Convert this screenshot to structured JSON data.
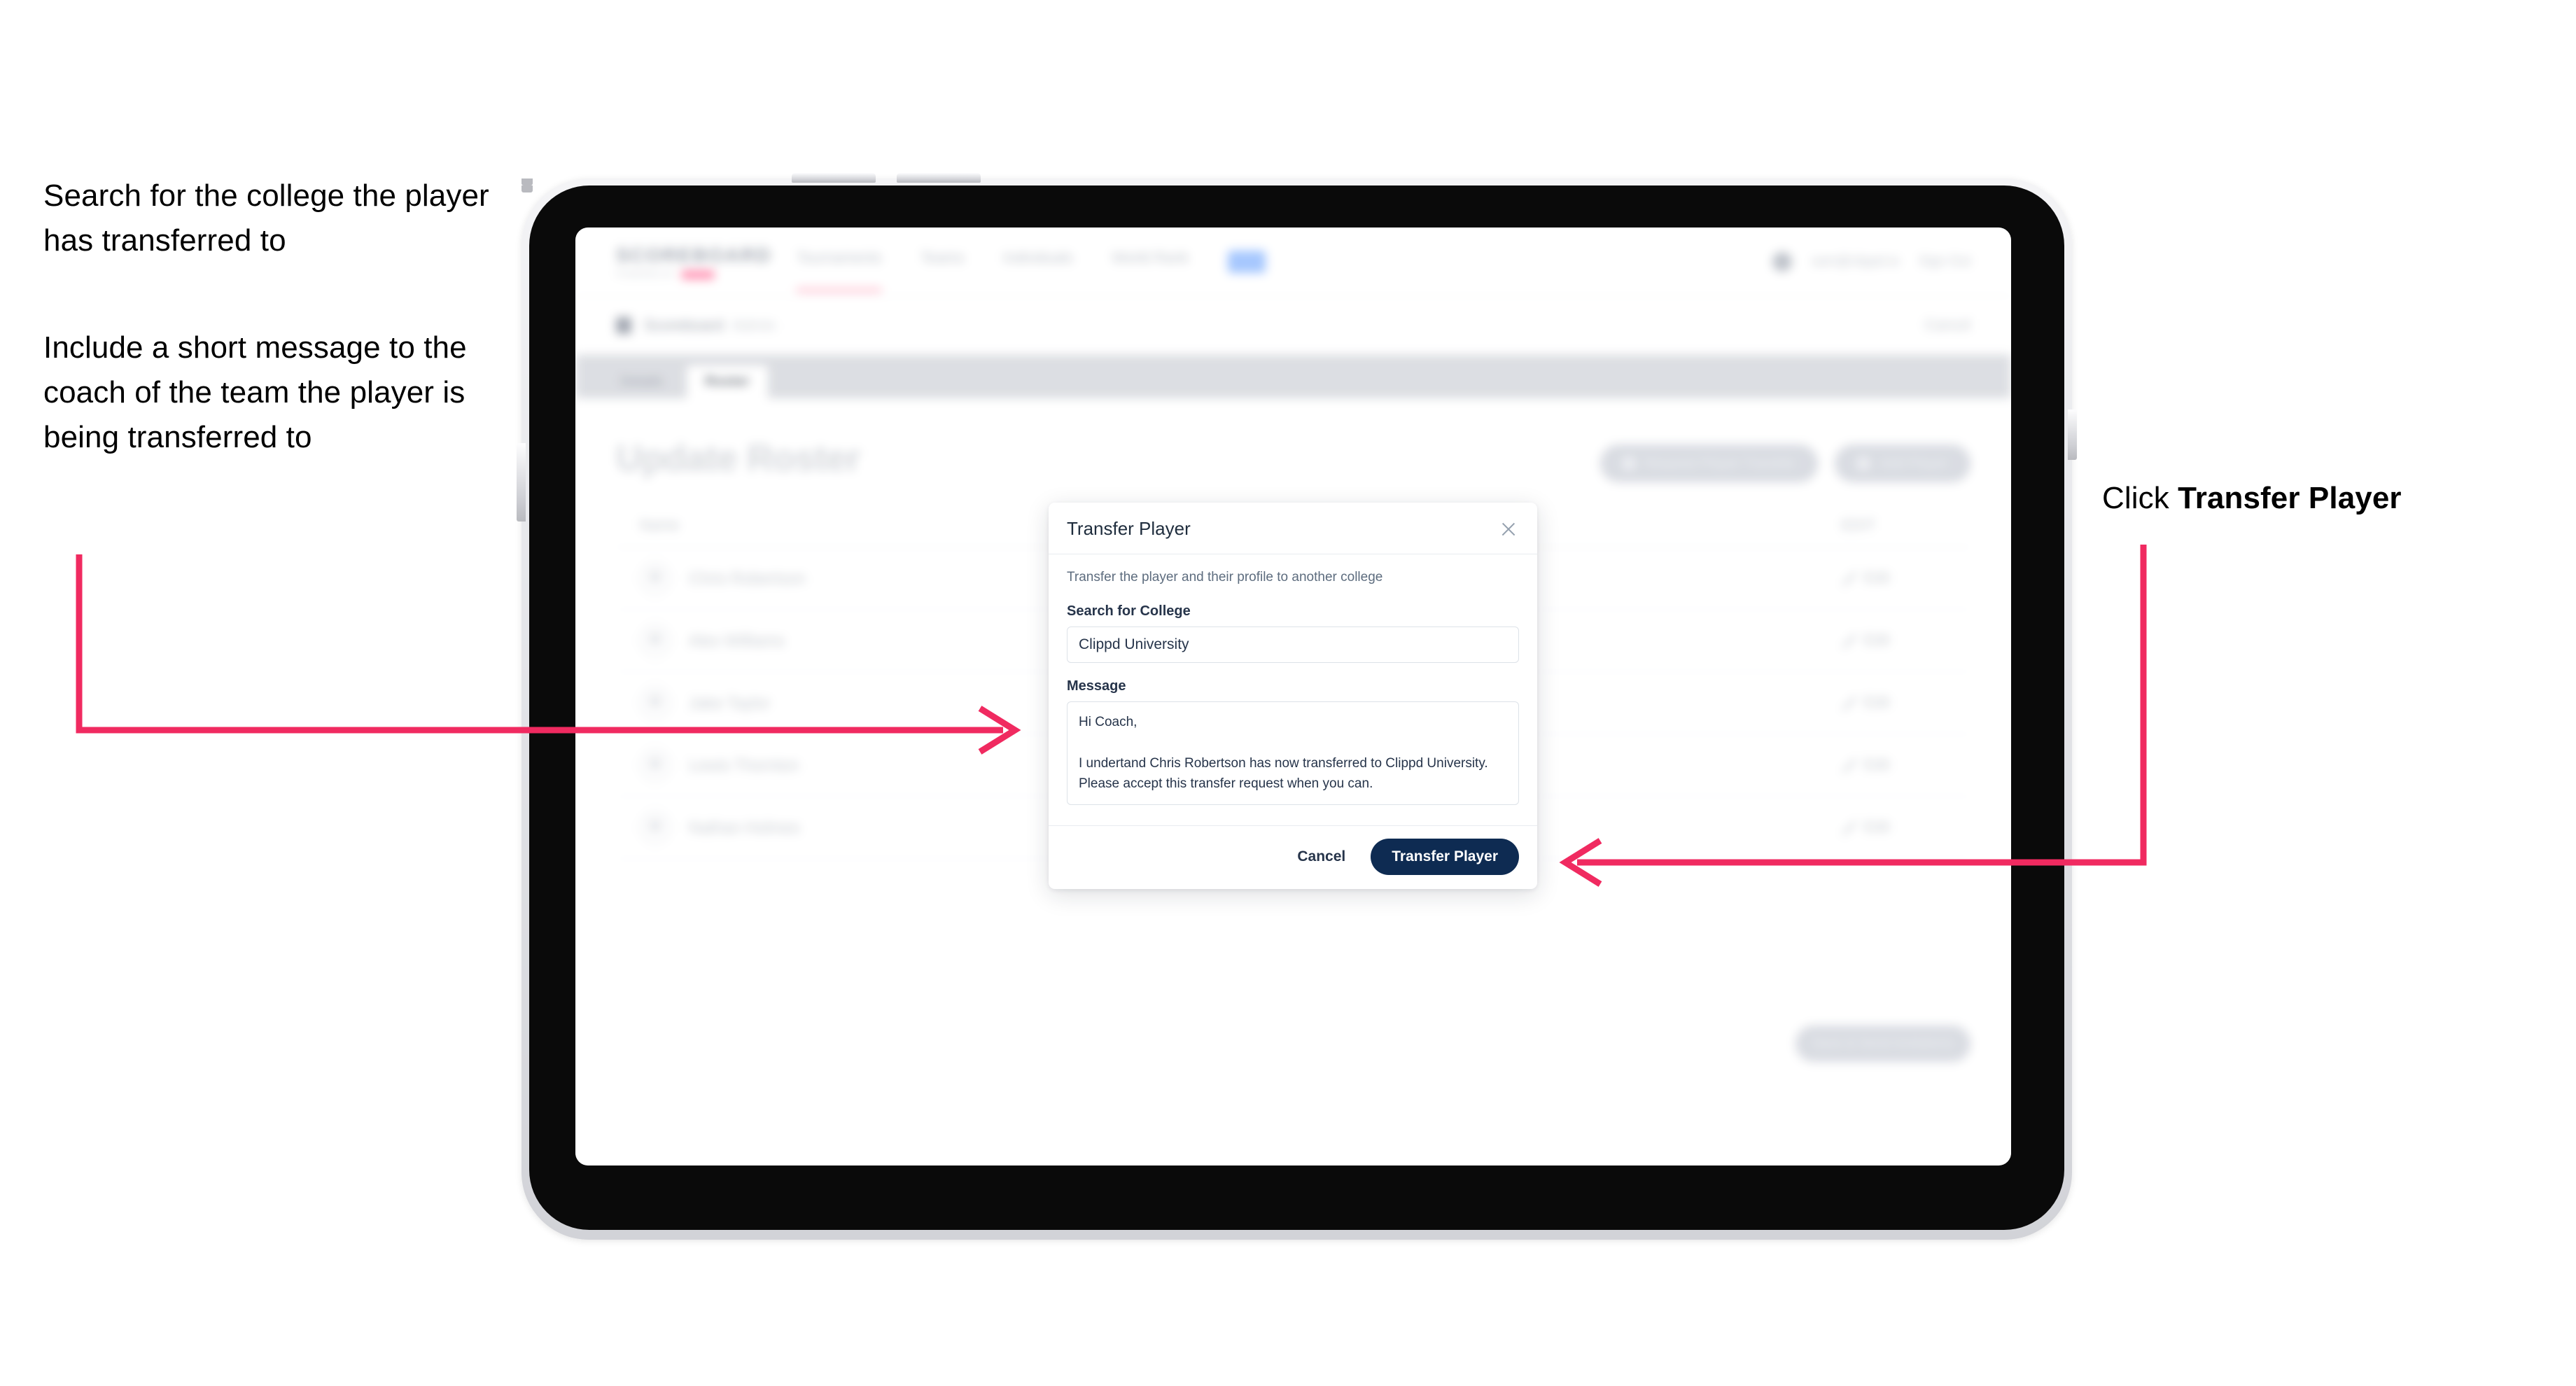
{
  "annotations": {
    "left_1": "Search for the college the player has transferred to",
    "left_2": "Include a short message to the coach of the team the player is being transferred to",
    "right_1_prefix": "Click ",
    "right_1_bold": "Transfer Player",
    "arrow_color": "#f02a60"
  },
  "app": {
    "brand": {
      "word": "SCOREBOARD",
      "sub_text": "POWERED BY"
    },
    "topnav": {
      "links": [
        {
          "label": "Tournaments"
        },
        {
          "label": "Teams"
        },
        {
          "label": "Individuals"
        },
        {
          "label": "World Rank"
        }
      ],
      "chip_label": "",
      "right": {
        "account": "sam@clippd.io",
        "signout": "Sign Out"
      }
    },
    "breadcrumb": {
      "main": "Scoreboard",
      "sub": "Admin",
      "right": "Cancel"
    },
    "tabs": [
      {
        "label": "Details",
        "active": false
      },
      {
        "label": "Roster",
        "active": true
      }
    ],
    "page_title": "Update Roster",
    "actions": [
      {
        "label": "Request Player Transfer"
      },
      {
        "label": "Add Player"
      }
    ],
    "roster": {
      "columns": {
        "name": "Name",
        "edit": "EDIT"
      },
      "rows": [
        {
          "name": "Chris Robertson",
          "edit": "Edit"
        },
        {
          "name": "Alex Williams",
          "edit": "Edit"
        },
        {
          "name": "Jake Taylor",
          "edit": "Edit"
        },
        {
          "name": "Lewis Thornton",
          "edit": "Edit"
        },
        {
          "name": "Nathan Holmes",
          "edit": "Edit"
        }
      ]
    },
    "bottom_cta": "Save & Send Invitations"
  },
  "modal": {
    "title": "Transfer Player",
    "close_icon": "close-icon",
    "description": "Transfer the player and their profile to another college",
    "college_field": {
      "label": "Search for College",
      "value": "Clippd University",
      "placeholder": "Search for College"
    },
    "message_field": {
      "label": "Message",
      "value": "Hi Coach,\n\nI undertand Chris Robertson has now transferred to Clippd University. Please accept this transfer request when you can.",
      "placeholder": "Write a message"
    },
    "cancel_label": "Cancel",
    "submit_label": "Transfer Player",
    "submit_color": "#0e2b52"
  }
}
